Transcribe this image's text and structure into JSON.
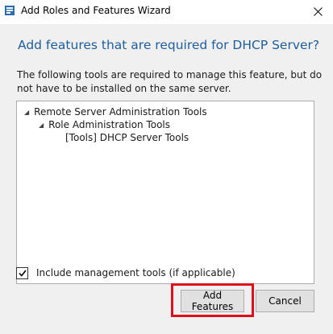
{
  "window": {
    "title": "Add Roles and Features Wizard",
    "icon": "server-manager-icon",
    "close_icon": "close-icon"
  },
  "dialog": {
    "heading": "Add features that are required for DHCP Server?",
    "description": "The following tools are required to manage this feature, but do not have to be installed on the same server.",
    "tree": [
      {
        "label": "Remote Server Administration Tools",
        "level": 0,
        "expanded": true
      },
      {
        "label": "Role Administration Tools",
        "level": 1,
        "expanded": true
      },
      {
        "label": "[Tools] DHCP Server Tools",
        "level": 2,
        "expanded": false
      }
    ],
    "include_tools": {
      "label": "Include management tools (if applicable)",
      "checked": true
    },
    "buttons": {
      "add": "Add Features",
      "cancel": "Cancel"
    }
  },
  "colors": {
    "heading": "#1e5d9e",
    "highlight": "#e00f1e"
  }
}
